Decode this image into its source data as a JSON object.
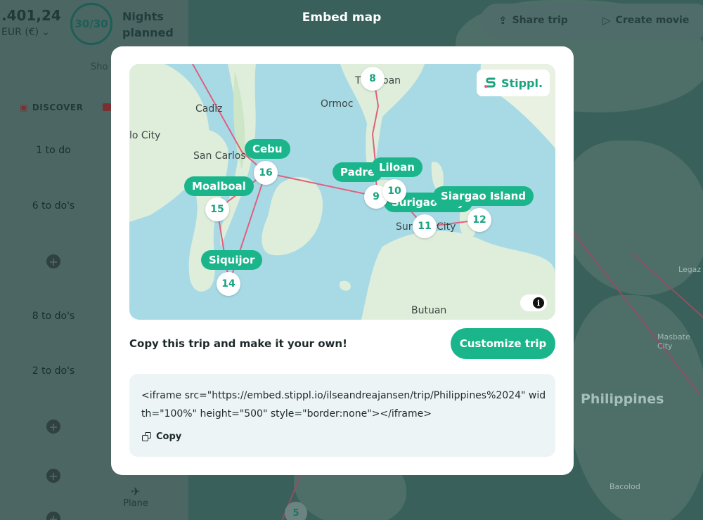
{
  "sidebar": {
    "budget_amount": ".401,24",
    "currency": "EUR (€)",
    "nights_progress": "30/30",
    "nights_label": "Nights planned",
    "show_link": "Sho",
    "discover_tab": "DISCOVER",
    "todos": [
      "1 to do",
      "6 to do's",
      "8 to do's",
      "2 to do's"
    ],
    "plane_label": "Plane"
  },
  "header": {
    "title": "Embed map",
    "share_trip": "Share trip",
    "create_movie": "Create movie"
  },
  "background_map": {
    "country_label": "Philippines",
    "labels": [
      "Legaz",
      "Masbate City",
      "Bacolod"
    ],
    "marker_number": "5"
  },
  "embed_map": {
    "brand": "Stippl.",
    "place_labels": [
      "Cadiz",
      "lo City",
      "San Carlos",
      "Ormoc",
      "T",
      "oan",
      "Butuan",
      "Sur",
      "City"
    ],
    "stops": [
      {
        "number": "8",
        "name": ""
      },
      {
        "number": "9",
        "name": "Padre"
      },
      {
        "number": "10",
        "name": "Liloan"
      },
      {
        "number": "11",
        "name": "Surigao City"
      },
      {
        "number": "12",
        "name": "Siargao Island"
      },
      {
        "number": "14",
        "name": "Siquijor"
      },
      {
        "number": "15",
        "name": "Moalboal"
      },
      {
        "number": "16",
        "name": "Cebu"
      }
    ],
    "info_symbol": "i"
  },
  "modal": {
    "copy_prompt": "Copy this trip and make it your own!",
    "customize_button": "Customize trip",
    "embed_code": "<iframe src=\"https://embed.stippl.io/ilseandreajansen/trip/Philippines%2024\" width=\"100%\" height=\"500\" style=\"border:none\"></iframe>",
    "copy_label": "Copy"
  },
  "colors": {
    "accent": "#1bb58c",
    "route": "#e0607e",
    "water": "#a8dae6",
    "land": "#dfeedb"
  }
}
